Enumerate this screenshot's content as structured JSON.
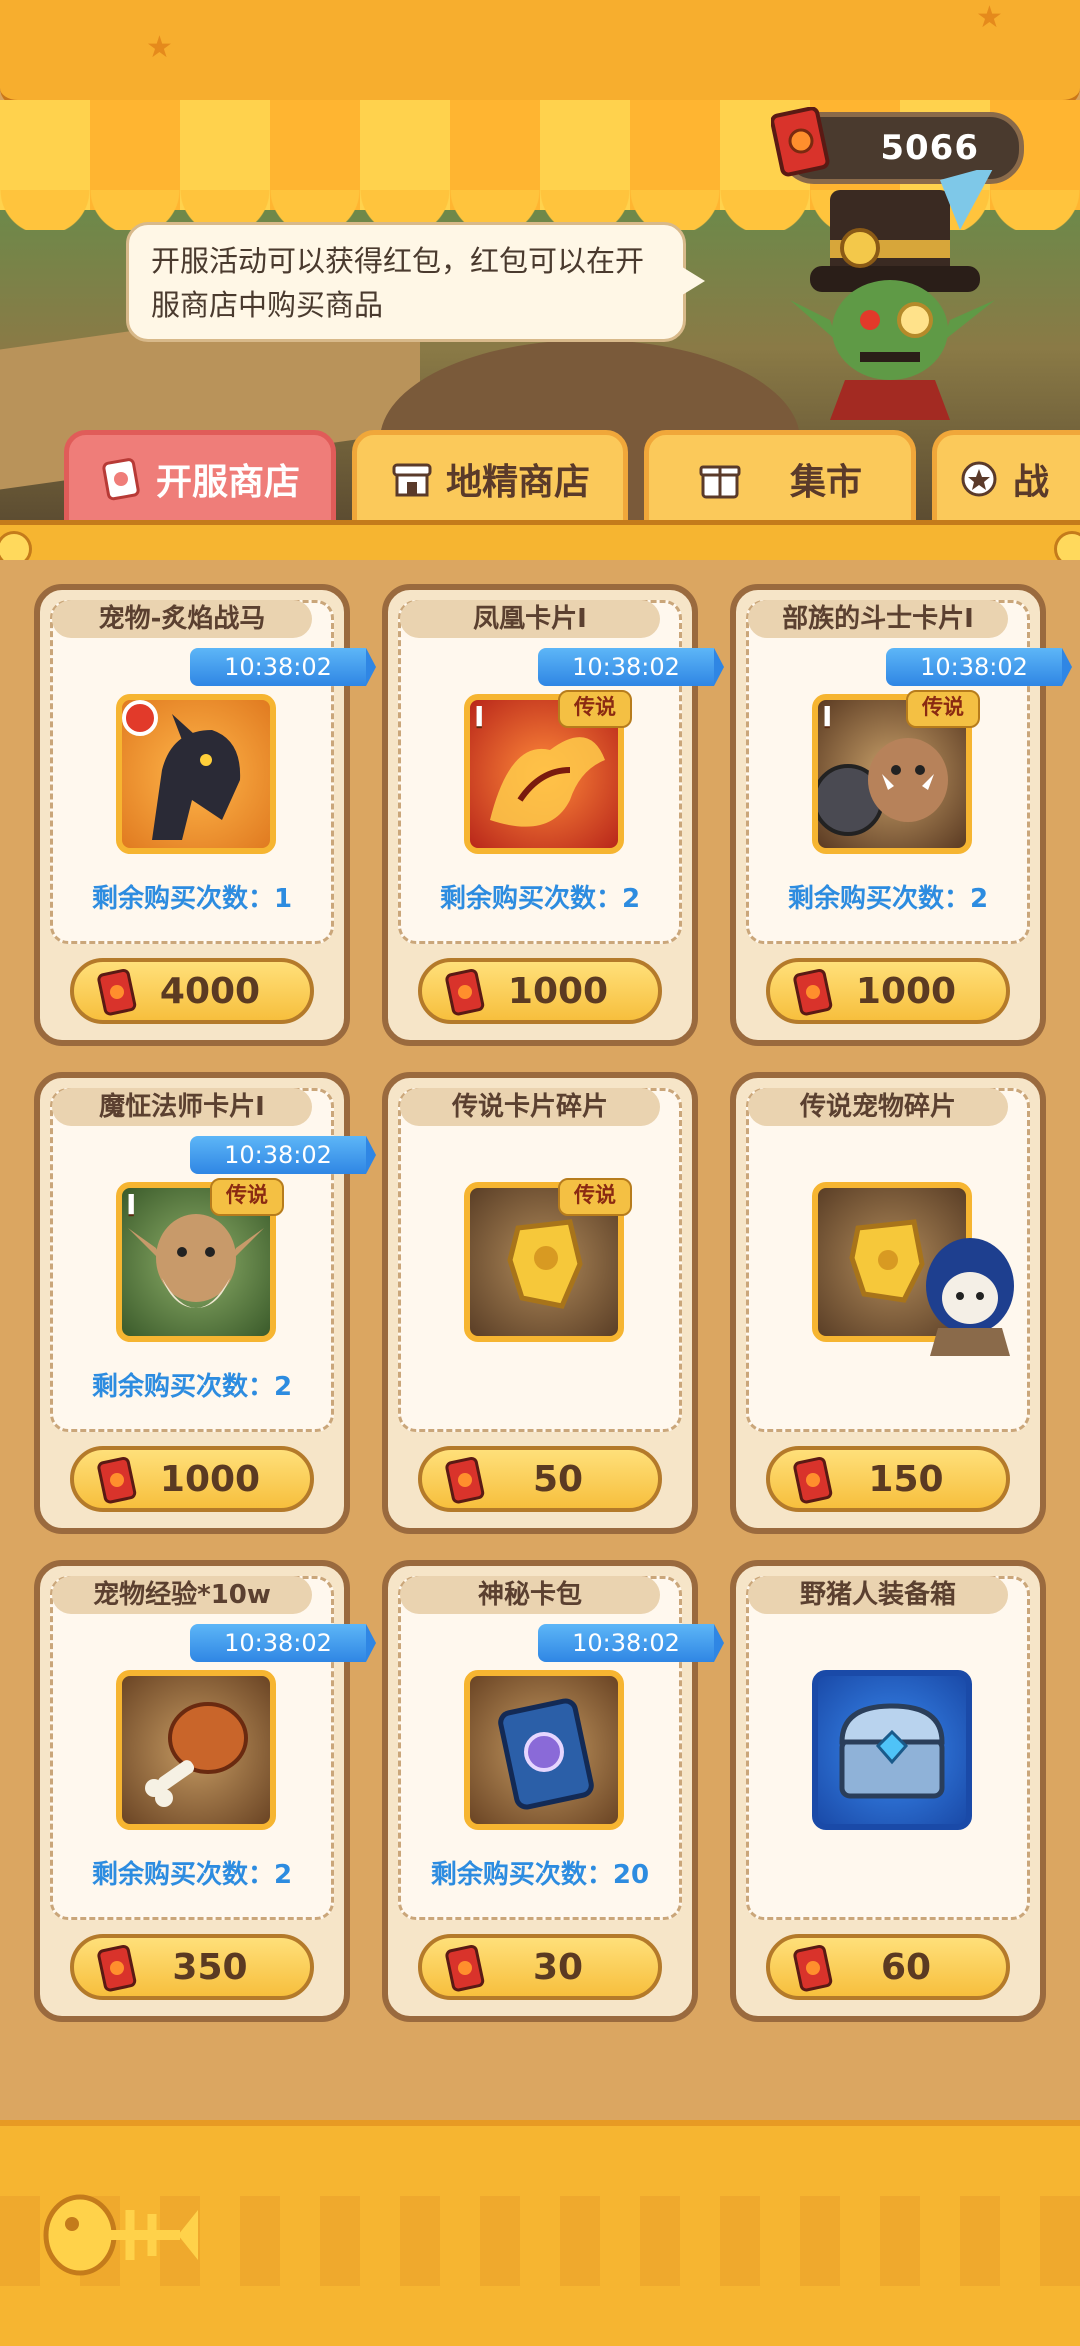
{
  "currency": {
    "amount": "5066"
  },
  "tip": {
    "text": "开服活动可以获得红包，红包可以在开服商店中购买商品"
  },
  "tabs": [
    {
      "label": "开服商店",
      "active": true
    },
    {
      "label": "地精商店",
      "active": false
    },
    {
      "label": "集市",
      "active": false
    },
    {
      "label": "战",
      "active": false
    }
  ],
  "remain_prefix": "剩余购买次数：",
  "items": [
    {
      "title": "宠物-炙焰战马",
      "timer": "10:38:02",
      "remain": "剩余购买次数：1",
      "price": "4000",
      "tag": "",
      "icon": "fire-horse-icon"
    },
    {
      "title": "凤凰卡片Ⅰ",
      "timer": "10:38:02",
      "remain": "剩余购买次数：2",
      "price": "1000",
      "tag": "传说",
      "icon": "phoenix-card-icon"
    },
    {
      "title": "部族的斗士卡片Ⅰ",
      "timer": "10:38:02",
      "remain": "剩余购买次数：2",
      "price": "1000",
      "tag": "传说",
      "icon": "tribal-warrior-card-icon"
    },
    {
      "title": "魔怔法师卡片Ⅰ",
      "timer": "10:38:02",
      "remain": "剩余购买次数：2",
      "price": "1000",
      "tag": "传说",
      "icon": "mage-card-icon"
    },
    {
      "title": "传说卡片碎片",
      "timer": "",
      "remain": "",
      "price": "50",
      "tag": "传说",
      "icon": "card-shard-icon"
    },
    {
      "title": "传说宠物碎片",
      "timer": "",
      "remain": "",
      "price": "150",
      "tag": "",
      "icon": "pet-shard-icon"
    },
    {
      "title": "宠物经验*10w",
      "timer": "10:38:02",
      "remain": "剩余购买次数：2",
      "price": "350",
      "tag": "",
      "icon": "drumstick-icon"
    },
    {
      "title": "神秘卡包",
      "timer": "10:38:02",
      "remain": "剩余购买次数：20",
      "price": "30",
      "tag": "",
      "icon": "mystery-card-pack-icon"
    },
    {
      "title": "野猪人装备箱",
      "timer": "",
      "remain": "",
      "price": "60",
      "tag": "",
      "icon": "equipment-chest-icon"
    }
  ],
  "rank_mark": "I",
  "colors": {
    "accent_tab": "#ef7d79",
    "timer_blue": "#2f86e4",
    "remain_blue": "#2d8ce0",
    "gold": "#f6b531"
  }
}
